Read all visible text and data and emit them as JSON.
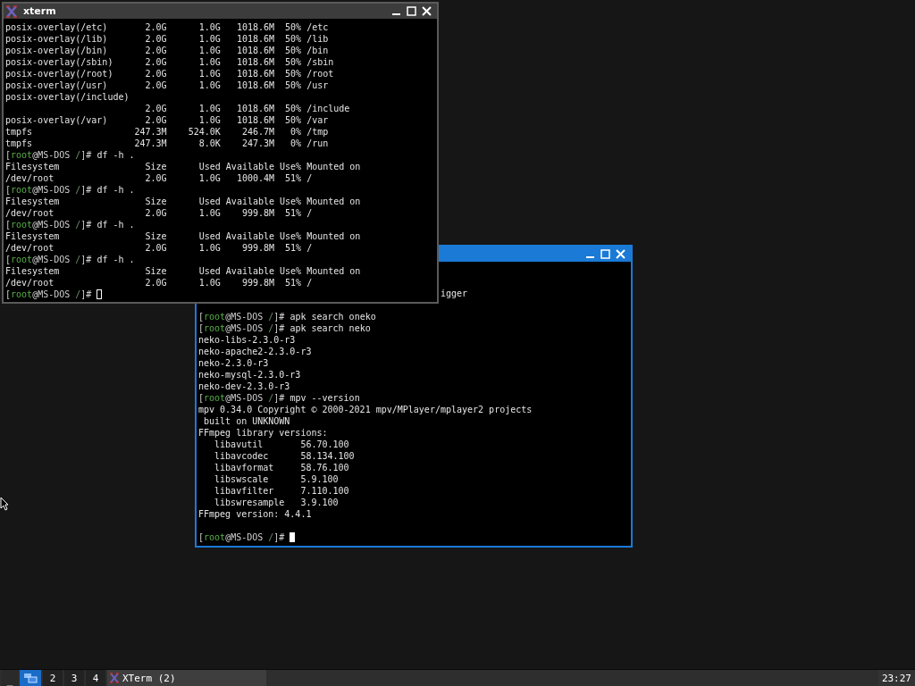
{
  "windows": [
    {
      "focused": true,
      "lines": [
        {
          "kind": "tail",
          "text": "igger"
        },
        {
          "kind": "blank"
        },
        {
          "kind": "prompt",
          "open": "[",
          "user": "root",
          "host": "@MS-DOS",
          "dir": "/",
          "close": "]#",
          "command": "apk search oneko"
        },
        {
          "kind": "prompt",
          "open": "[",
          "user": "root",
          "host": "@MS-DOS",
          "dir": "/",
          "close": "]#",
          "command": "apk search neko"
        },
        {
          "kind": "output",
          "text": "neko-libs-2.3.0-r3"
        },
        {
          "kind": "output",
          "text": "neko-apache2-2.3.0-r3"
        },
        {
          "kind": "output",
          "text": "neko-2.3.0-r3"
        },
        {
          "kind": "output",
          "text": "neko-mysql-2.3.0-r3"
        },
        {
          "kind": "output",
          "text": "neko-dev-2.3.0-r3"
        },
        {
          "kind": "prompt",
          "open": "[",
          "user": "root",
          "host": "@MS-DOS",
          "dir": "/",
          "close": "]#",
          "command": "mpv --version"
        },
        {
          "kind": "output",
          "text": "mpv 0.34.0 Copyright © 2000-2021 mpv/MPlayer/mplayer2 projects"
        },
        {
          "kind": "output",
          "text": " built on UNKNOWN"
        },
        {
          "kind": "output",
          "text": "FFmpeg library versions:"
        },
        {
          "kind": "output",
          "text": "   libavutil       56.70.100"
        },
        {
          "kind": "output",
          "text": "   libavcodec      58.134.100"
        },
        {
          "kind": "output",
          "text": "   libavformat     58.76.100"
        },
        {
          "kind": "output",
          "text": "   libswscale      5.9.100"
        },
        {
          "kind": "output",
          "text": "   libavfilter     7.110.100"
        },
        {
          "kind": "output",
          "text": "   libswresample   3.9.100"
        },
        {
          "kind": "output",
          "text": "FFmpeg version: 4.4.1"
        },
        {
          "kind": "blank"
        },
        {
          "kind": "prompt",
          "open": "[",
          "user": "root",
          "host": "@MS-DOS",
          "dir": "/",
          "close": "]#",
          "cursor": true
        }
      ]
    },
    {
      "title": "xterm",
      "focused": false,
      "lines": [
        {
          "kind": "output",
          "text": "posix-overlay(/etc)       2.0G      1.0G   1018.6M  50% /etc"
        },
        {
          "kind": "output",
          "text": "posix-overlay(/lib)       2.0G      1.0G   1018.6M  50% /lib"
        },
        {
          "kind": "output",
          "text": "posix-overlay(/bin)       2.0G      1.0G   1018.6M  50% /bin"
        },
        {
          "kind": "output",
          "text": "posix-overlay(/sbin)      2.0G      1.0G   1018.6M  50% /sbin"
        },
        {
          "kind": "output",
          "text": "posix-overlay(/root)      2.0G      1.0G   1018.6M  50% /root"
        },
        {
          "kind": "output",
          "text": "posix-overlay(/usr)       2.0G      1.0G   1018.6M  50% /usr"
        },
        {
          "kind": "output",
          "text": "posix-overlay(/include)"
        },
        {
          "kind": "output",
          "text": "                          2.0G      1.0G   1018.6M  50% /include"
        },
        {
          "kind": "output",
          "text": "posix-overlay(/var)       2.0G      1.0G   1018.6M  50% /var"
        },
        {
          "kind": "output",
          "text": "tmpfs                   247.3M    524.0K    246.7M   0% /tmp"
        },
        {
          "kind": "output",
          "text": "tmpfs                   247.3M      8.0K    247.3M   0% /run"
        },
        {
          "kind": "prompt",
          "open": "[",
          "user": "root",
          "host": "@MS-DOS",
          "dir": "/",
          "close": "]#",
          "command": "df -h ."
        },
        {
          "kind": "output",
          "text": "Filesystem                Size      Used Available Use% Mounted on"
        },
        {
          "kind": "output",
          "text": "/dev/root                 2.0G      1.0G   1000.4M  51% /"
        },
        {
          "kind": "prompt",
          "open": "[",
          "user": "root",
          "host": "@MS-DOS",
          "dir": "/",
          "close": "]#",
          "command": "df -h ."
        },
        {
          "kind": "output",
          "text": "Filesystem                Size      Used Available Use% Mounted on"
        },
        {
          "kind": "output",
          "text": "/dev/root                 2.0G      1.0G    999.8M  51% /"
        },
        {
          "kind": "prompt",
          "open": "[",
          "user": "root",
          "host": "@MS-DOS",
          "dir": "/",
          "close": "]#",
          "command": "df -h ."
        },
        {
          "kind": "output",
          "text": "Filesystem                Size      Used Available Use% Mounted on"
        },
        {
          "kind": "output",
          "text": "/dev/root                 2.0G      1.0G    999.8M  51% /"
        },
        {
          "kind": "prompt",
          "open": "[",
          "user": "root",
          "host": "@MS-DOS",
          "dir": "/",
          "close": "]#",
          "command": "df -h ."
        },
        {
          "kind": "output",
          "text": "Filesystem                Size      Used Available Use% Mounted on"
        },
        {
          "kind": "output",
          "text": "/dev/root                 2.0G      1.0G    999.8M  51% /"
        },
        {
          "kind": "prompt",
          "open": "[",
          "user": "root",
          "host": "@MS-DOS",
          "dir": "/",
          "close": "]#",
          "cursor": true
        }
      ]
    }
  ],
  "taskbar": {
    "show_desktop": "_",
    "desktops": [
      {
        "selected": true
      },
      {
        "label": "2",
        "selected": false
      },
      {
        "label": "3",
        "selected": false
      },
      {
        "label": "4",
        "selected": false
      }
    ],
    "tasks": [
      {
        "title": "XTerm (2)"
      }
    ],
    "clock": "23:27"
  }
}
